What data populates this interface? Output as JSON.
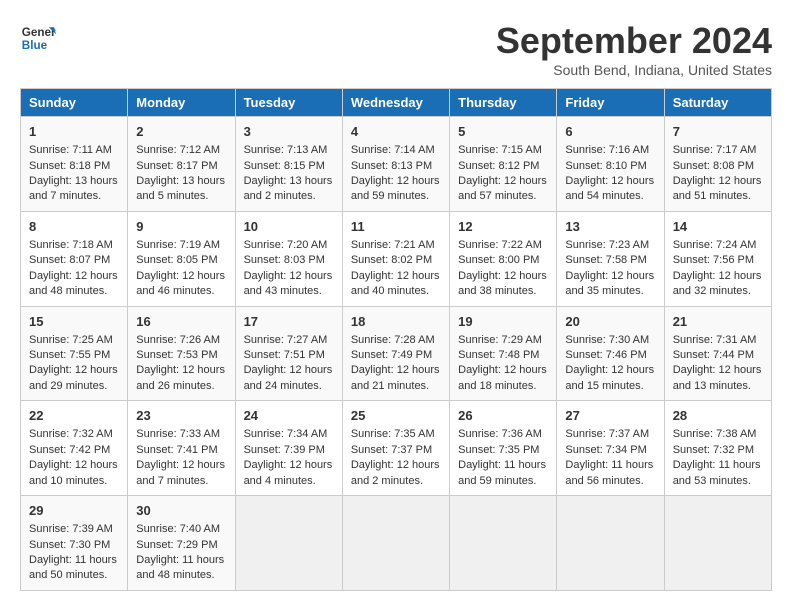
{
  "header": {
    "logo_line1": "General",
    "logo_line2": "Blue",
    "title": "September 2024",
    "subtitle": "South Bend, Indiana, United States"
  },
  "days_of_week": [
    "Sunday",
    "Monday",
    "Tuesday",
    "Wednesday",
    "Thursday",
    "Friday",
    "Saturday"
  ],
  "weeks": [
    [
      {
        "num": "1",
        "lines": [
          "Sunrise: 7:11 AM",
          "Sunset: 8:18 PM",
          "Daylight: 13 hours",
          "and 7 minutes."
        ]
      },
      {
        "num": "2",
        "lines": [
          "Sunrise: 7:12 AM",
          "Sunset: 8:17 PM",
          "Daylight: 13 hours",
          "and 5 minutes."
        ]
      },
      {
        "num": "3",
        "lines": [
          "Sunrise: 7:13 AM",
          "Sunset: 8:15 PM",
          "Daylight: 13 hours",
          "and 2 minutes."
        ]
      },
      {
        "num": "4",
        "lines": [
          "Sunrise: 7:14 AM",
          "Sunset: 8:13 PM",
          "Daylight: 12 hours",
          "and 59 minutes."
        ]
      },
      {
        "num": "5",
        "lines": [
          "Sunrise: 7:15 AM",
          "Sunset: 8:12 PM",
          "Daylight: 12 hours",
          "and 57 minutes."
        ]
      },
      {
        "num": "6",
        "lines": [
          "Sunrise: 7:16 AM",
          "Sunset: 8:10 PM",
          "Daylight: 12 hours",
          "and 54 minutes."
        ]
      },
      {
        "num": "7",
        "lines": [
          "Sunrise: 7:17 AM",
          "Sunset: 8:08 PM",
          "Daylight: 12 hours",
          "and 51 minutes."
        ]
      }
    ],
    [
      {
        "num": "8",
        "lines": [
          "Sunrise: 7:18 AM",
          "Sunset: 8:07 PM",
          "Daylight: 12 hours",
          "and 48 minutes."
        ]
      },
      {
        "num": "9",
        "lines": [
          "Sunrise: 7:19 AM",
          "Sunset: 8:05 PM",
          "Daylight: 12 hours",
          "and 46 minutes."
        ]
      },
      {
        "num": "10",
        "lines": [
          "Sunrise: 7:20 AM",
          "Sunset: 8:03 PM",
          "Daylight: 12 hours",
          "and 43 minutes."
        ]
      },
      {
        "num": "11",
        "lines": [
          "Sunrise: 7:21 AM",
          "Sunset: 8:02 PM",
          "Daylight: 12 hours",
          "and 40 minutes."
        ]
      },
      {
        "num": "12",
        "lines": [
          "Sunrise: 7:22 AM",
          "Sunset: 8:00 PM",
          "Daylight: 12 hours",
          "and 38 minutes."
        ]
      },
      {
        "num": "13",
        "lines": [
          "Sunrise: 7:23 AM",
          "Sunset: 7:58 PM",
          "Daylight: 12 hours",
          "and 35 minutes."
        ]
      },
      {
        "num": "14",
        "lines": [
          "Sunrise: 7:24 AM",
          "Sunset: 7:56 PM",
          "Daylight: 12 hours",
          "and 32 minutes."
        ]
      }
    ],
    [
      {
        "num": "15",
        "lines": [
          "Sunrise: 7:25 AM",
          "Sunset: 7:55 PM",
          "Daylight: 12 hours",
          "and 29 minutes."
        ]
      },
      {
        "num": "16",
        "lines": [
          "Sunrise: 7:26 AM",
          "Sunset: 7:53 PM",
          "Daylight: 12 hours",
          "and 26 minutes."
        ]
      },
      {
        "num": "17",
        "lines": [
          "Sunrise: 7:27 AM",
          "Sunset: 7:51 PM",
          "Daylight: 12 hours",
          "and 24 minutes."
        ]
      },
      {
        "num": "18",
        "lines": [
          "Sunrise: 7:28 AM",
          "Sunset: 7:49 PM",
          "Daylight: 12 hours",
          "and 21 minutes."
        ]
      },
      {
        "num": "19",
        "lines": [
          "Sunrise: 7:29 AM",
          "Sunset: 7:48 PM",
          "Daylight: 12 hours",
          "and 18 minutes."
        ]
      },
      {
        "num": "20",
        "lines": [
          "Sunrise: 7:30 AM",
          "Sunset: 7:46 PM",
          "Daylight: 12 hours",
          "and 15 minutes."
        ]
      },
      {
        "num": "21",
        "lines": [
          "Sunrise: 7:31 AM",
          "Sunset: 7:44 PM",
          "Daylight: 12 hours",
          "and 13 minutes."
        ]
      }
    ],
    [
      {
        "num": "22",
        "lines": [
          "Sunrise: 7:32 AM",
          "Sunset: 7:42 PM",
          "Daylight: 12 hours",
          "and 10 minutes."
        ]
      },
      {
        "num": "23",
        "lines": [
          "Sunrise: 7:33 AM",
          "Sunset: 7:41 PM",
          "Daylight: 12 hours",
          "and 7 minutes."
        ]
      },
      {
        "num": "24",
        "lines": [
          "Sunrise: 7:34 AM",
          "Sunset: 7:39 PM",
          "Daylight: 12 hours",
          "and 4 minutes."
        ]
      },
      {
        "num": "25",
        "lines": [
          "Sunrise: 7:35 AM",
          "Sunset: 7:37 PM",
          "Daylight: 12 hours",
          "and 2 minutes."
        ]
      },
      {
        "num": "26",
        "lines": [
          "Sunrise: 7:36 AM",
          "Sunset: 7:35 PM",
          "Daylight: 11 hours",
          "and 59 minutes."
        ]
      },
      {
        "num": "27",
        "lines": [
          "Sunrise: 7:37 AM",
          "Sunset: 7:34 PM",
          "Daylight: 11 hours",
          "and 56 minutes."
        ]
      },
      {
        "num": "28",
        "lines": [
          "Sunrise: 7:38 AM",
          "Sunset: 7:32 PM",
          "Daylight: 11 hours",
          "and 53 minutes."
        ]
      }
    ],
    [
      {
        "num": "29",
        "lines": [
          "Sunrise: 7:39 AM",
          "Sunset: 7:30 PM",
          "Daylight: 11 hours",
          "and 50 minutes."
        ]
      },
      {
        "num": "30",
        "lines": [
          "Sunrise: 7:40 AM",
          "Sunset: 7:29 PM",
          "Daylight: 11 hours",
          "and 48 minutes."
        ]
      },
      {
        "num": "",
        "lines": []
      },
      {
        "num": "",
        "lines": []
      },
      {
        "num": "",
        "lines": []
      },
      {
        "num": "",
        "lines": []
      },
      {
        "num": "",
        "lines": []
      }
    ]
  ]
}
